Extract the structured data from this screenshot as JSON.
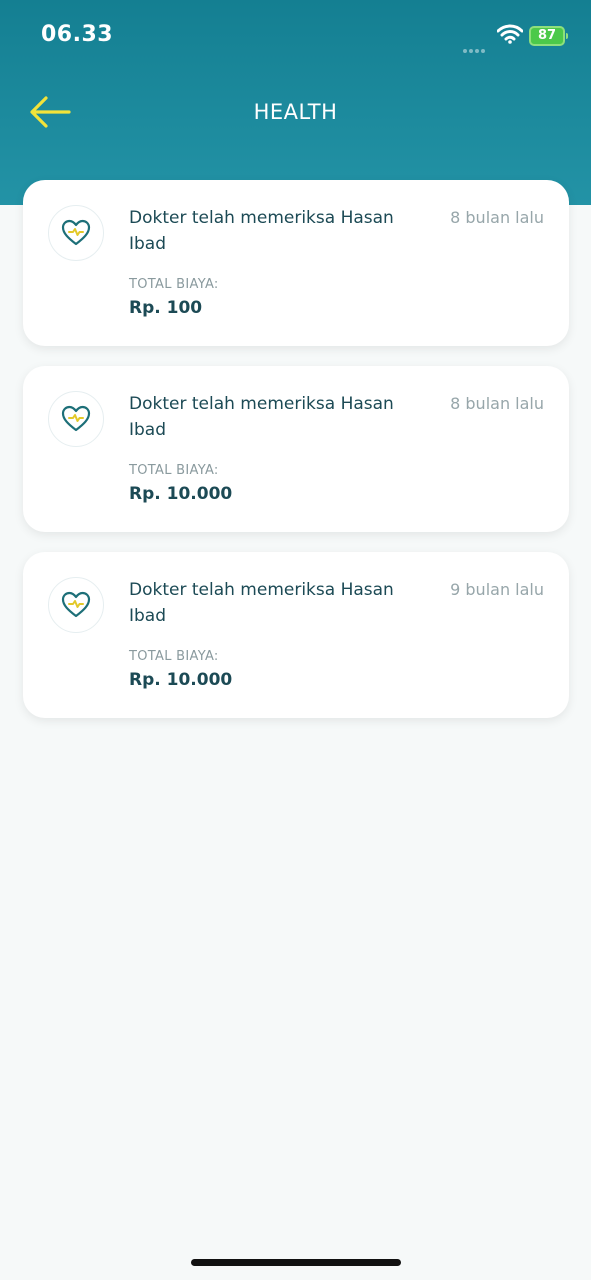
{
  "status_bar": {
    "time": "06.33",
    "battery": "87"
  },
  "header": {
    "title": "HEALTH"
  },
  "records": [
    {
      "title": "Dokter telah memeriksa Hasan Ibad",
      "time_ago": "8 bulan lalu",
      "cost_label": "TOTAL BIAYA:",
      "cost_value": "Rp. 100"
    },
    {
      "title": "Dokter telah memeriksa Hasan Ibad",
      "time_ago": "8 bulan lalu",
      "cost_label": "TOTAL BIAYA:",
      "cost_value": "Rp. 10.000"
    },
    {
      "title": "Dokter telah memeriksa Hasan Ibad",
      "time_ago": "9 bulan lalu",
      "cost_label": "TOTAL BIAYA:",
      "cost_value": "Rp. 10.000"
    }
  ],
  "icons": {
    "back": "arrow-left-icon",
    "record": "heart-pulse-icon"
  },
  "colors": {
    "header_top": "#147f92",
    "header_bottom": "#2393a6",
    "back_arrow": "#f2e33a",
    "text_primary": "#1c4a55",
    "text_muted": "#97a6aa",
    "heart_stroke": "#1d6f78",
    "pulse_line": "#e3c92a"
  }
}
